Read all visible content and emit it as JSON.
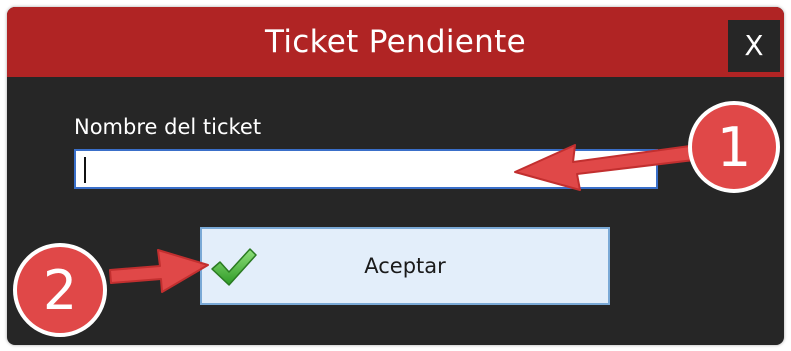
{
  "dialog": {
    "title": "Ticket Pendiente",
    "close_label": "X",
    "field_label": "Nombre del ticket",
    "field_value": "",
    "accept_label": "Aceptar"
  },
  "annotations": [
    {
      "number": "1"
    },
    {
      "number": "2"
    }
  ],
  "colors": {
    "titlebar": "#b02424",
    "body": "#262626",
    "annotation": "#e04848"
  },
  "icons": {
    "accept": "checkmark-icon"
  }
}
